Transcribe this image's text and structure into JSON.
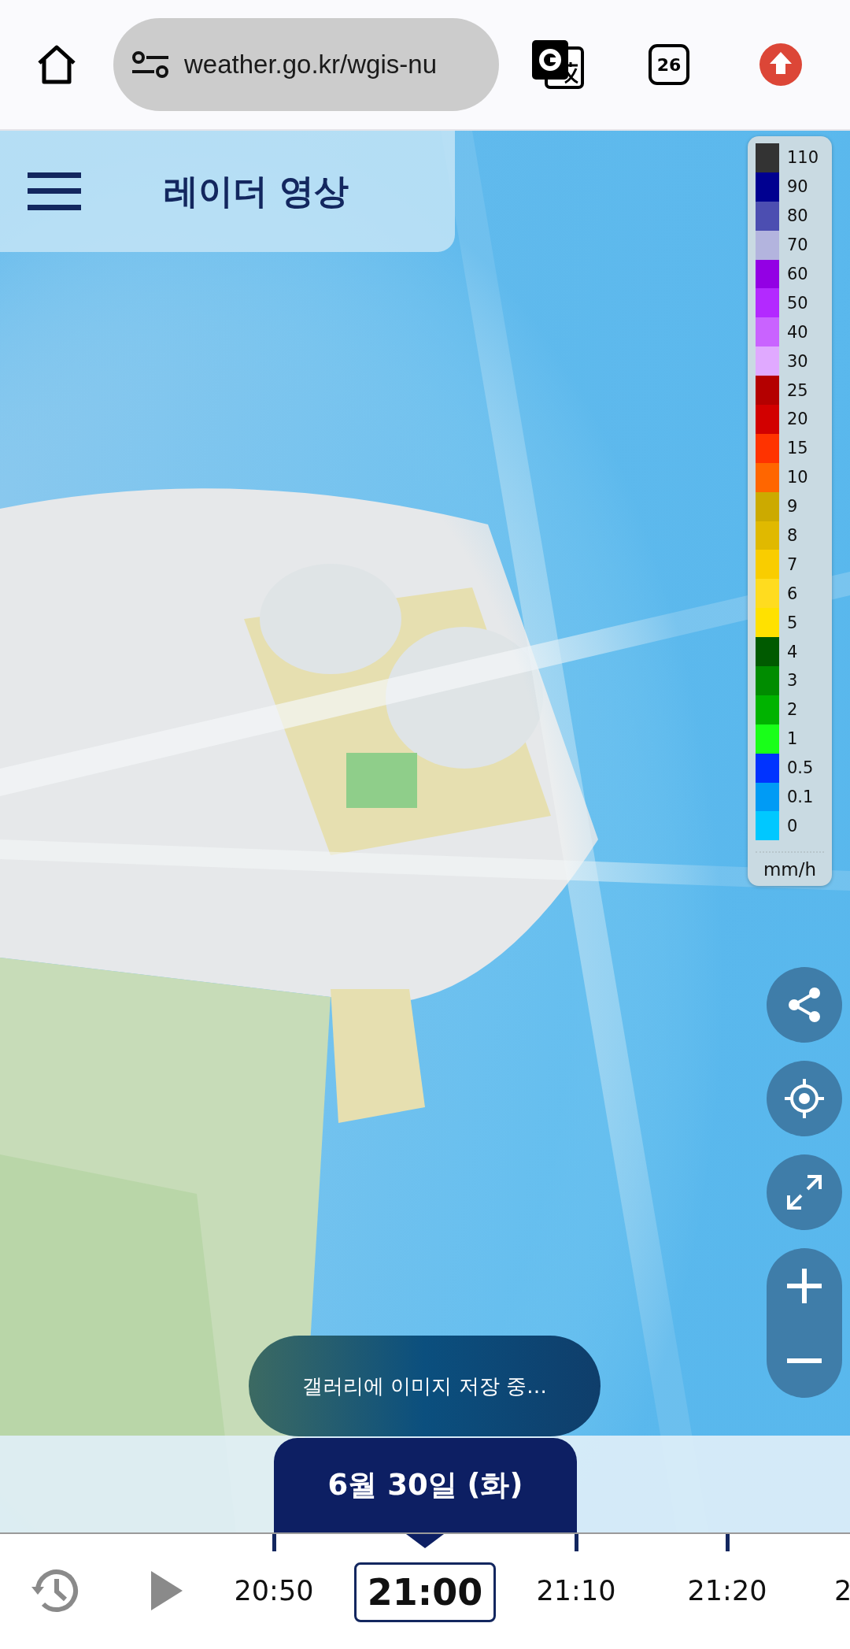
{
  "browser": {
    "url": "weather.go.kr/wgis-nu",
    "tab_count": "26"
  },
  "header": {
    "title": "레이더 영상"
  },
  "legend": {
    "items": [
      {
        "label": "110",
        "color": "#333333"
      },
      {
        "label": "90",
        "color": "#000090"
      },
      {
        "label": "80",
        "color": "#4c4eb1"
      },
      {
        "label": "70",
        "color": "#b3b4de"
      },
      {
        "label": "60",
        "color": "#9300e4"
      },
      {
        "label": "50",
        "color": "#b329ff"
      },
      {
        "label": "40",
        "color": "#c963ff"
      },
      {
        "label": "30",
        "color": "#e0a9ff"
      },
      {
        "label": "25",
        "color": "#b40000"
      },
      {
        "label": "20",
        "color": "#d20000"
      },
      {
        "label": "15",
        "color": "#ff3300"
      },
      {
        "label": "10",
        "color": "#ff6600"
      },
      {
        "label": "9",
        "color": "#ccaa00"
      },
      {
        "label": "8",
        "color": "#e0b900"
      },
      {
        "label": "7",
        "color": "#f9cd00"
      },
      {
        "label": "6",
        "color": "#ffdc1f"
      },
      {
        "label": "5",
        "color": "#ffe100"
      },
      {
        "label": "4",
        "color": "#005a00"
      },
      {
        "label": "3",
        "color": "#008c00"
      },
      {
        "label": "2",
        "color": "#00b300"
      },
      {
        "label": "1",
        "color": "#19ff19"
      },
      {
        "label": "0.5",
        "color": "#0033ff"
      },
      {
        "label": "0.1",
        "color": "#009bf5"
      },
      {
        "label": "0",
        "color": "#00c8ff"
      }
    ],
    "unit": "mm/h"
  },
  "toast": "갤러리에 이미지 저장 중…",
  "date": "6월 30일 (화)",
  "timeline": {
    "times": [
      {
        "label": "20:50",
        "selected": false
      },
      {
        "label": "21:00",
        "selected": true
      },
      {
        "label": "21:10",
        "selected": false
      },
      {
        "label": "21:20",
        "selected": false
      },
      {
        "label": "2",
        "selected": false
      }
    ]
  }
}
